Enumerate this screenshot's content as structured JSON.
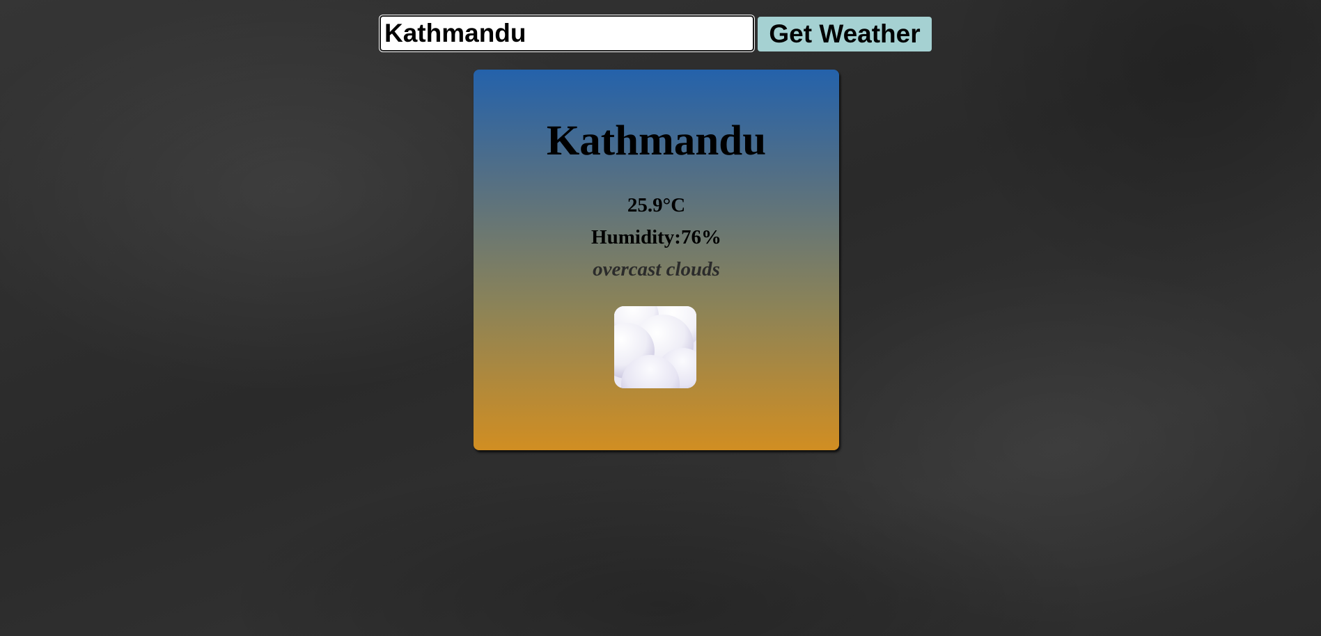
{
  "search": {
    "value": "Kathmandu",
    "button_label": "Get Weather"
  },
  "weather": {
    "city": "Kathmandu",
    "temperature": "25.9°C",
    "humidity": "Humidity:76%",
    "description": "overcast clouds",
    "icon": "overcast-clouds-icon"
  },
  "colors": {
    "button_bg": "#a5d1d2",
    "card_top": "#2462ab",
    "card_bottom": "#d18e22",
    "page_bg": "#2e2e2e"
  }
}
